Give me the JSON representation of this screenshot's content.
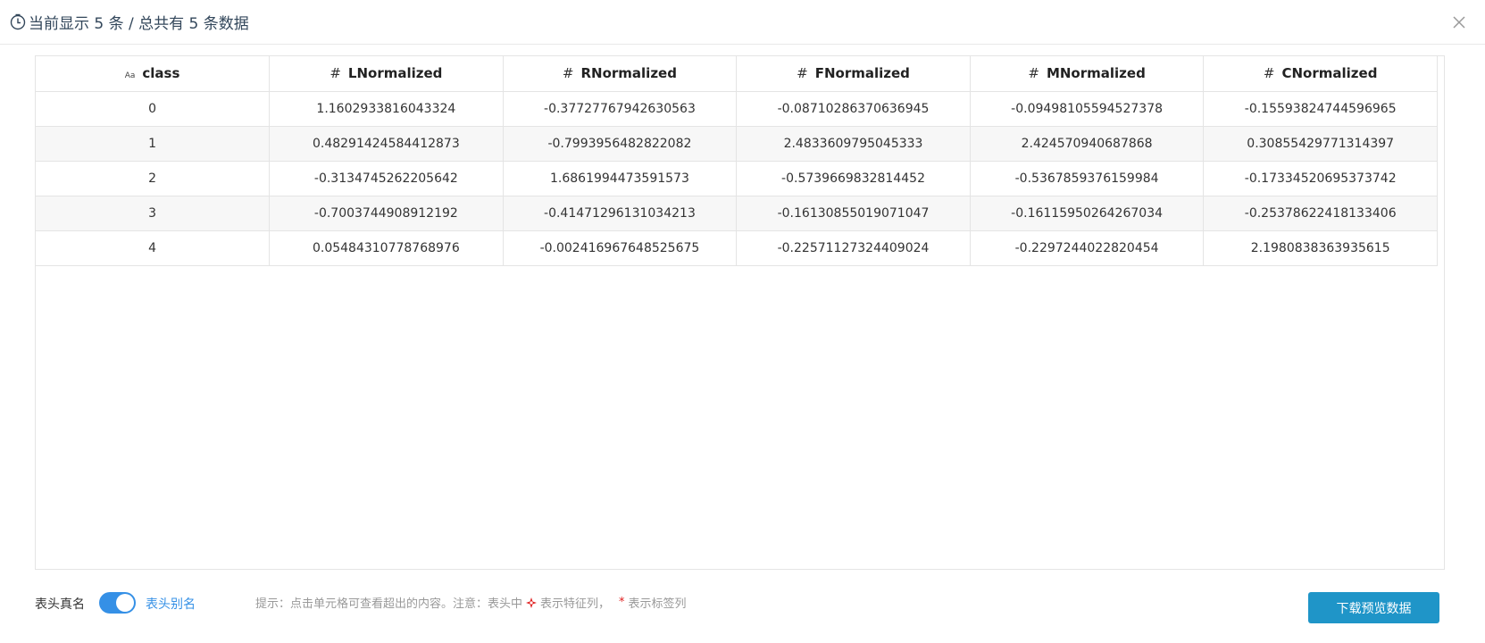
{
  "header": {
    "title": "当前显示 5 条 / 总共有 5 条数据",
    "icon": "clock-icon",
    "close_icon": "close-icon"
  },
  "table": {
    "columns": [
      {
        "type_icon": "Aa",
        "label": "class"
      },
      {
        "type_icon": "#",
        "label": "LNormalized"
      },
      {
        "type_icon": "#",
        "label": "RNormalized"
      },
      {
        "type_icon": "#",
        "label": "FNormalized"
      },
      {
        "type_icon": "#",
        "label": "MNormalized"
      },
      {
        "type_icon": "#",
        "label": "CNormalized"
      }
    ],
    "rows": [
      [
        "0",
        "1.1602933816043324",
        "-0.37727767942630563",
        "-0.08710286370636945",
        "-0.09498105594527378",
        "-0.15593824744596965"
      ],
      [
        "1",
        "0.48291424584412873",
        "-0.7993956482822082",
        "2.4833609795045333",
        "2.424570940687868",
        "0.30855429771314397"
      ],
      [
        "2",
        "-0.3134745262205642",
        "1.6861994473591573",
        "-0.5739669832814452",
        "-0.5367859376159984",
        "-0.17334520695373742"
      ],
      [
        "3",
        "-0.7003744908912192",
        "-0.41471296131034213",
        "-0.16130855019071047",
        "-0.16115950264267034",
        "-0.25378622418133406"
      ],
      [
        "4",
        "0.05484310778768976",
        "-0.002416967648525675",
        "-0.22571127324409024",
        "-0.2297244022820454",
        "2.1980838363935615"
      ]
    ]
  },
  "footer": {
    "real_name_label": "表头真名",
    "alias_label": "表头别名",
    "toggle_on": true,
    "hint_prefix": "提示：点击单元格可查看超出的内容。注意：表头中",
    "hint_feature": "表示特征列，",
    "hint_star": "*",
    "hint_label": "表示标签列",
    "download_label": "下载预览数据"
  },
  "colors": {
    "accent": "#3590e6",
    "button": "#1f95c8",
    "star": "#e02020"
  }
}
